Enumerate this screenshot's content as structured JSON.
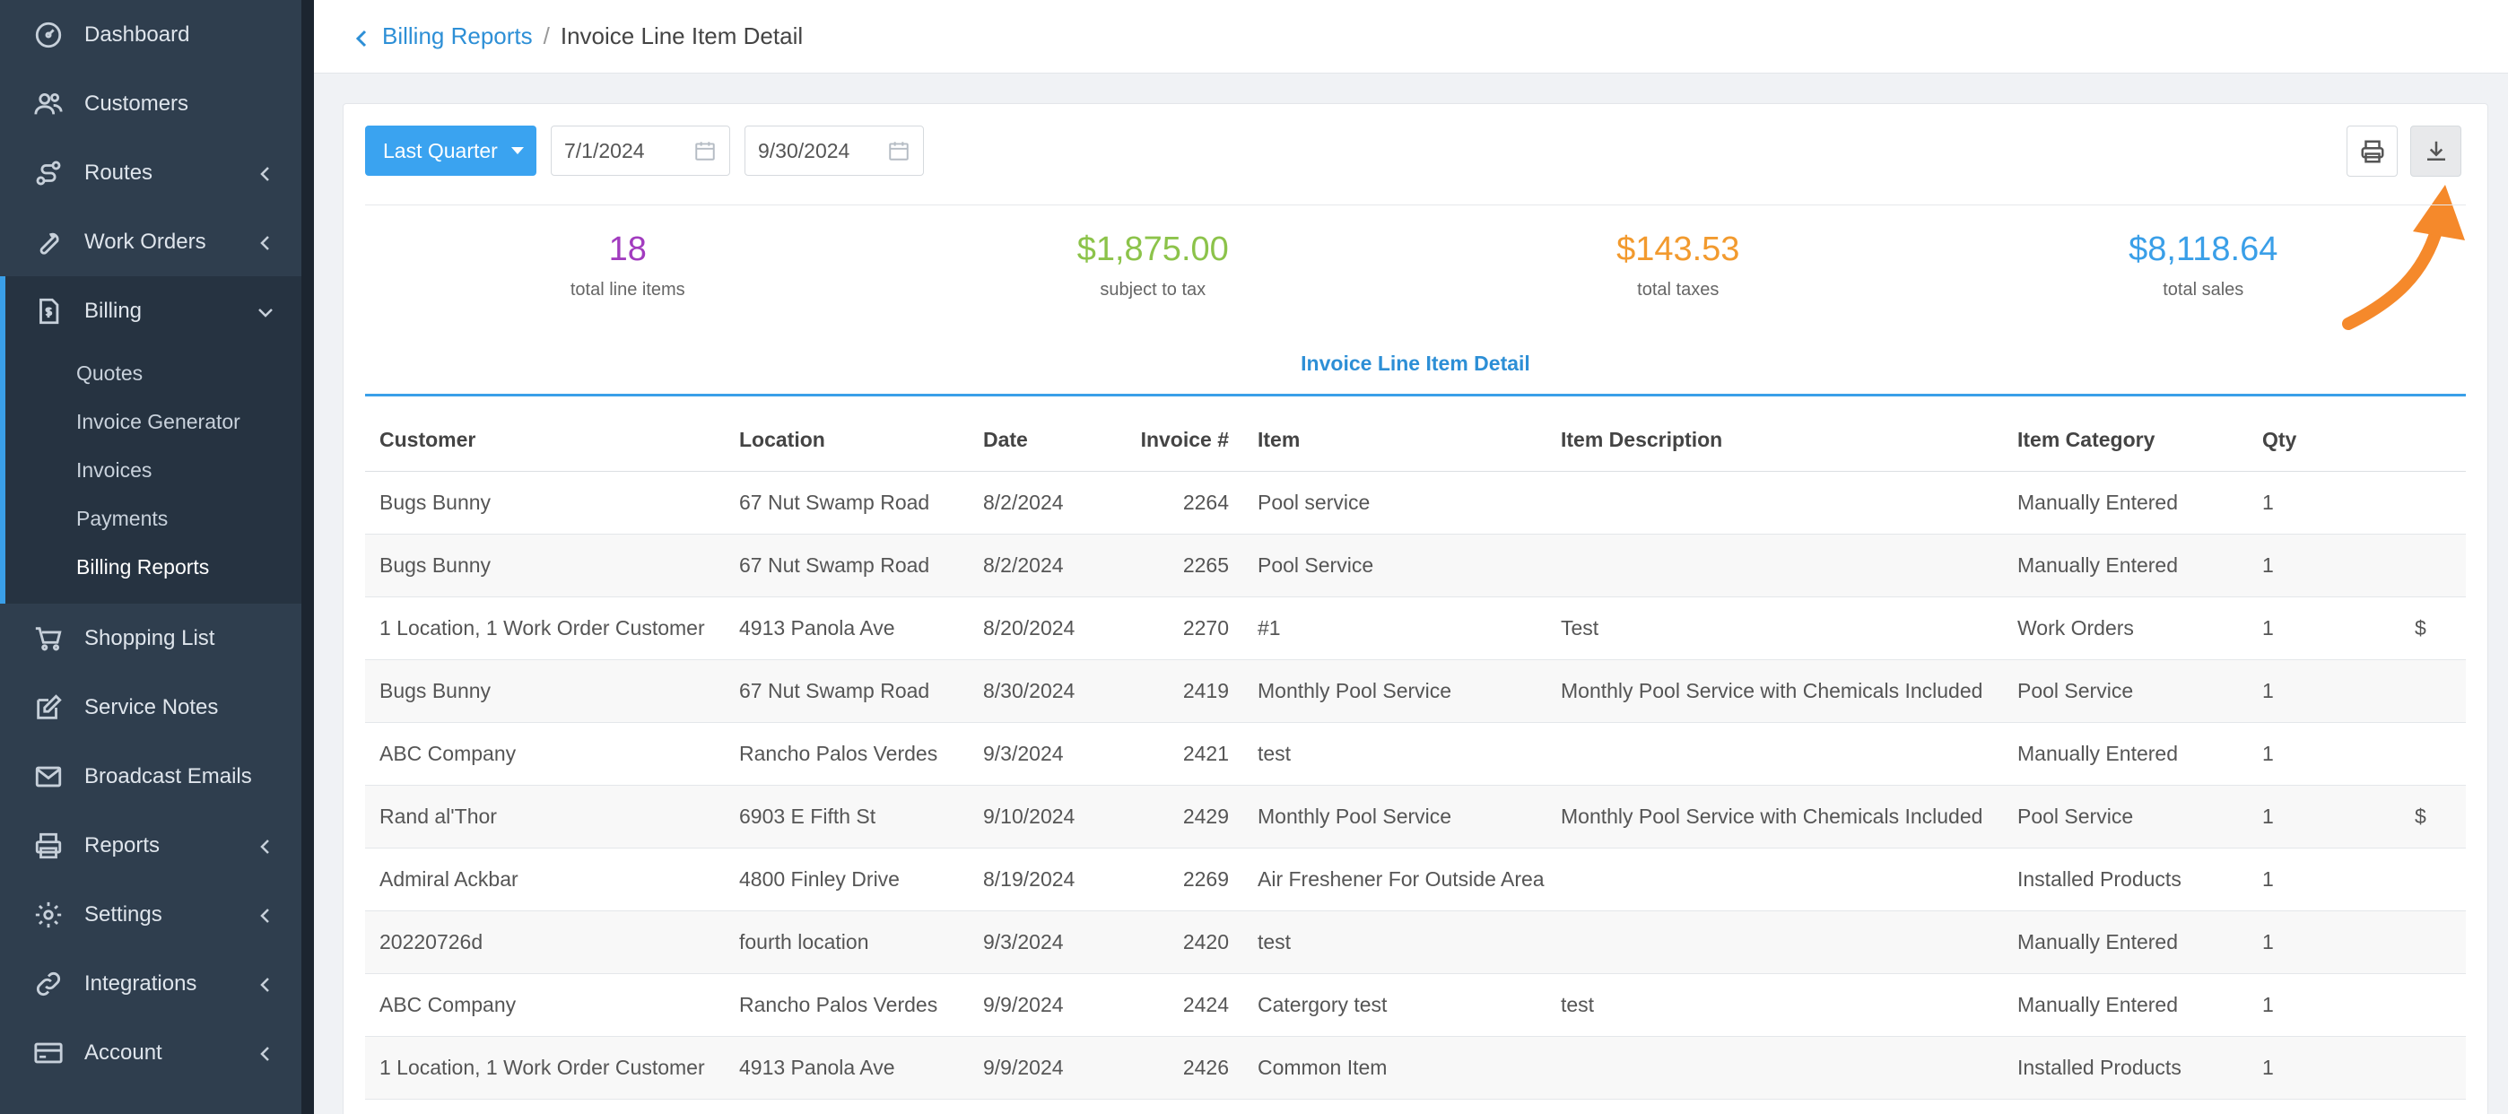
{
  "sidebar": {
    "items": [
      {
        "label": "Dashboard",
        "icon": "dashboard-icon",
        "chevron": false
      },
      {
        "label": "Customers",
        "icon": "customers-icon",
        "chevron": false
      },
      {
        "label": "Routes",
        "icon": "routes-icon",
        "chevron": true
      },
      {
        "label": "Work Orders",
        "icon": "wrench-icon",
        "chevron": true
      },
      {
        "label": "Billing",
        "icon": "billing-icon",
        "chevron": true,
        "expanded": true
      },
      {
        "label": "Shopping List",
        "icon": "cart-icon",
        "chevron": false
      },
      {
        "label": "Service Notes",
        "icon": "edit-icon",
        "chevron": false
      },
      {
        "label": "Broadcast Emails",
        "icon": "mail-icon",
        "chevron": false
      },
      {
        "label": "Reports",
        "icon": "printer-icon",
        "chevron": true
      },
      {
        "label": "Settings",
        "icon": "gear-icon",
        "chevron": true
      },
      {
        "label": "Integrations",
        "icon": "link-icon",
        "chevron": true
      },
      {
        "label": "Account",
        "icon": "card-icon",
        "chevron": true
      }
    ],
    "billing_sub": [
      "Quotes",
      "Invoice Generator",
      "Invoices",
      "Payments",
      "Billing Reports"
    ]
  },
  "breadcrumb": {
    "parent": "Billing Reports",
    "separator": "/",
    "current": "Invoice Line Item Detail"
  },
  "toolbar": {
    "range_label": "Last Quarter",
    "start_date": "7/1/2024",
    "end_date": "9/30/2024"
  },
  "stats": [
    {
      "value": "18",
      "label": "total line items",
      "color": "#a23cbf"
    },
    {
      "value": "$1,875.00",
      "label": "subject to tax",
      "color": "#8cc34a"
    },
    {
      "value": "$143.53",
      "label": "total taxes",
      "color": "#f29a2e"
    },
    {
      "value": "$8,118.64",
      "label": "total sales",
      "color": "#3a9fe8"
    }
  ],
  "section_title": "Invoice Line Item Detail",
  "table": {
    "headers": [
      "Customer",
      "Location",
      "Date",
      "Invoice #",
      "Item",
      "Item Description",
      "Item Category",
      "Qty",
      ""
    ],
    "rows": [
      [
        "Bugs Bunny",
        "67 Nut Swamp Road",
        "8/2/2024",
        "2264",
        "Pool service",
        "",
        "Manually Entered",
        "1",
        ""
      ],
      [
        "Bugs Bunny",
        "67 Nut Swamp Road",
        "8/2/2024",
        "2265",
        "Pool Service",
        "",
        "Manually Entered",
        "1",
        ""
      ],
      [
        "1 Location, 1 Work Order Customer",
        "4913 Panola Ave",
        "8/20/2024",
        "2270",
        "#1",
        "Test",
        "Work Orders",
        "1",
        "$"
      ],
      [
        "Bugs Bunny",
        "67 Nut Swamp Road",
        "8/30/2024",
        "2419",
        "Monthly Pool Service",
        "Monthly Pool Service with Chemicals Included",
        "Pool Service",
        "1",
        ""
      ],
      [
        "ABC Company",
        "Rancho Palos Verdes",
        "9/3/2024",
        "2421",
        "test",
        "",
        "Manually Entered",
        "1",
        ""
      ],
      [
        "Rand al'Thor",
        "6903 E Fifth St",
        "9/10/2024",
        "2429",
        "Monthly Pool Service",
        "Monthly Pool Service with Chemicals Included",
        "Pool Service",
        "1",
        "$"
      ],
      [
        "Admiral Ackbar",
        "4800 Finley Drive",
        "8/19/2024",
        "2269",
        "Air Freshener For Outside Area",
        "",
        "Installed Products",
        "1",
        ""
      ],
      [
        "20220726d",
        "fourth location",
        "9/3/2024",
        "2420",
        "test",
        "",
        "Manually Entered",
        "1",
        ""
      ],
      [
        "ABC Company",
        "Rancho Palos Verdes",
        "9/9/2024",
        "2424",
        "Catergory test",
        "test",
        "Manually Entered",
        "1",
        ""
      ],
      [
        "1 Location, 1 Work Order Customer",
        "4913 Panola Ave",
        "9/9/2024",
        "2426",
        "Common Item",
        "",
        "Installed Products",
        "1",
        ""
      ]
    ]
  },
  "colors": {
    "sidebar_bg": "#2f3e4e",
    "accent": "#3a9fe8",
    "annotation_arrow": "#f5892b"
  }
}
